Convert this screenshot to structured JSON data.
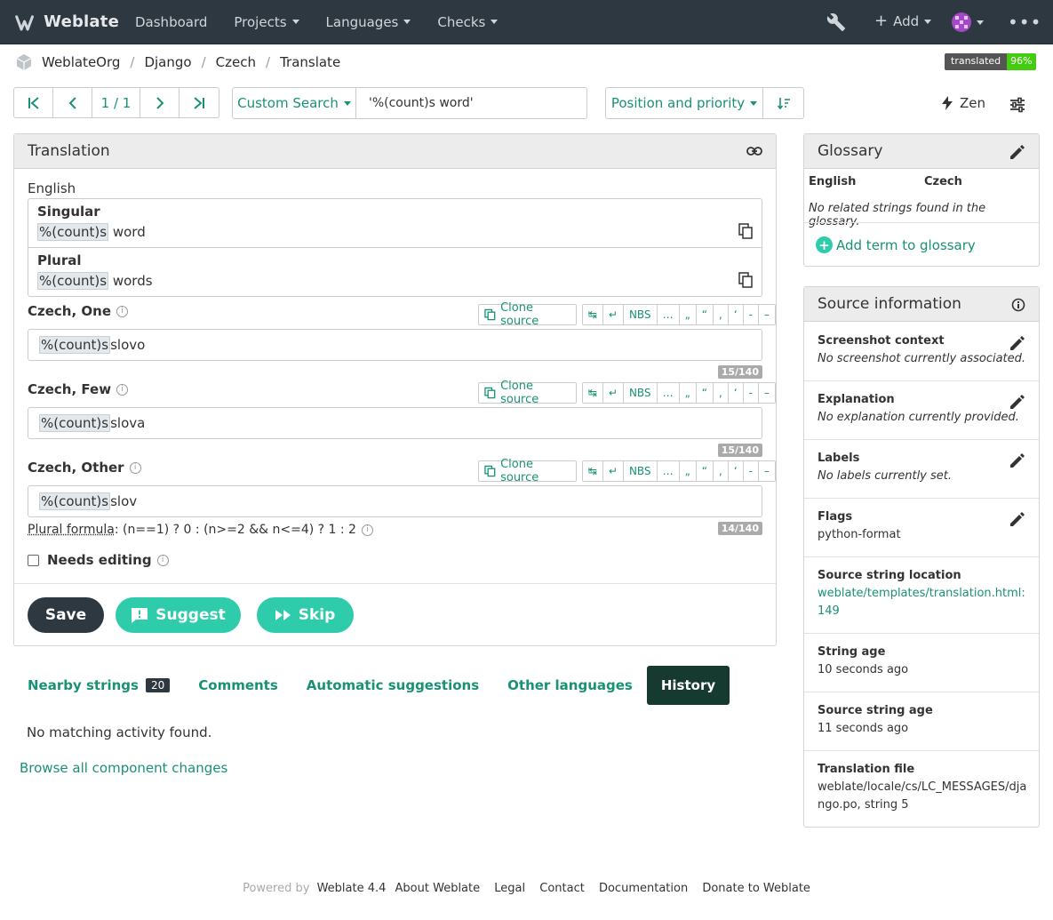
{
  "app": {
    "name": "Weblate"
  },
  "nav": {
    "dashboard": "Dashboard",
    "projects": "Projects",
    "languages": "Languages",
    "checks": "Checks",
    "add": "Add"
  },
  "breadcrumb": {
    "items": [
      "WeblateOrg",
      "Django",
      "Czech",
      "Translate"
    ],
    "badge_label": "translated",
    "badge_value": "96%"
  },
  "toolbar": {
    "page_position": "1 / 1",
    "search_type": "Custom Search",
    "search_value": "'%(count)s word'",
    "sort_label": "Position and priority",
    "zen_label": "Zen"
  },
  "translation": {
    "title": "Translation",
    "source_language": "English",
    "singular_label": "Singular",
    "singular_placeholder": "%(count)s",
    "singular_rest": " word",
    "plural_label": "Plural",
    "plural_placeholder": "%(count)s",
    "plural_rest": " words",
    "clone_label": "Clone source",
    "special_chars": [
      "↹",
      "↵",
      "NBS",
      "…",
      "„",
      "“",
      ",",
      "‘",
      "-",
      "–"
    ],
    "targets": [
      {
        "label": "Czech, One",
        "placeholder": "%(count)s",
        "rest": " slovo",
        "counter": "15/140"
      },
      {
        "label": "Czech, Few",
        "placeholder": "%(count)s",
        "rest": " slova",
        "counter": "15/140"
      },
      {
        "label": "Czech, Other",
        "placeholder": "%(count)s",
        "rest": " slov",
        "counter": "14/140"
      }
    ],
    "plural_formula_label": "Plural formula",
    "plural_formula_value": ": (n==1) ? 0 : (n>=2 && n<=4) ? 1 : 2",
    "needs_editing": "Needs editing",
    "save": "Save",
    "suggest": "Suggest",
    "skip": "Skip"
  },
  "tabs": {
    "nearby": "Nearby strings",
    "nearby_count": "20",
    "comments": "Comments",
    "automatic": "Automatic suggestions",
    "other": "Other languages",
    "history": "History"
  },
  "history": {
    "empty": "No matching activity found.",
    "browse": "Browse all component changes"
  },
  "glossary": {
    "title": "Glossary",
    "col_source": "English",
    "col_target": "Czech",
    "empty": "No related strings found in the glossary.",
    "add": "Add term to glossary"
  },
  "source_info": {
    "title": "Source information",
    "screenshot_title": "Screenshot context",
    "screenshot_value": "No screenshot currently associated.",
    "explanation_title": "Explanation",
    "explanation_value": "No explanation currently provided.",
    "labels_title": "Labels",
    "labels_value": "No labels currently set.",
    "flags_title": "Flags",
    "flags_value": "python-format",
    "location_title": "Source string location",
    "location_value": "weblate/templates/translation.html:149",
    "age_title": "String age",
    "age_value": "10 seconds ago",
    "source_age_title": "Source string age",
    "source_age_value": "11 seconds ago",
    "file_title": "Translation file",
    "file_value": "weblate/locale/cs/LC_MESSAGES/django.po, string 5"
  },
  "footer": {
    "powered": "Powered by",
    "version": "Weblate 4.4",
    "about": "About Weblate",
    "legal": "Legal",
    "contact": "Contact",
    "docs": "Documentation",
    "donate": "Donate to Weblate"
  }
}
